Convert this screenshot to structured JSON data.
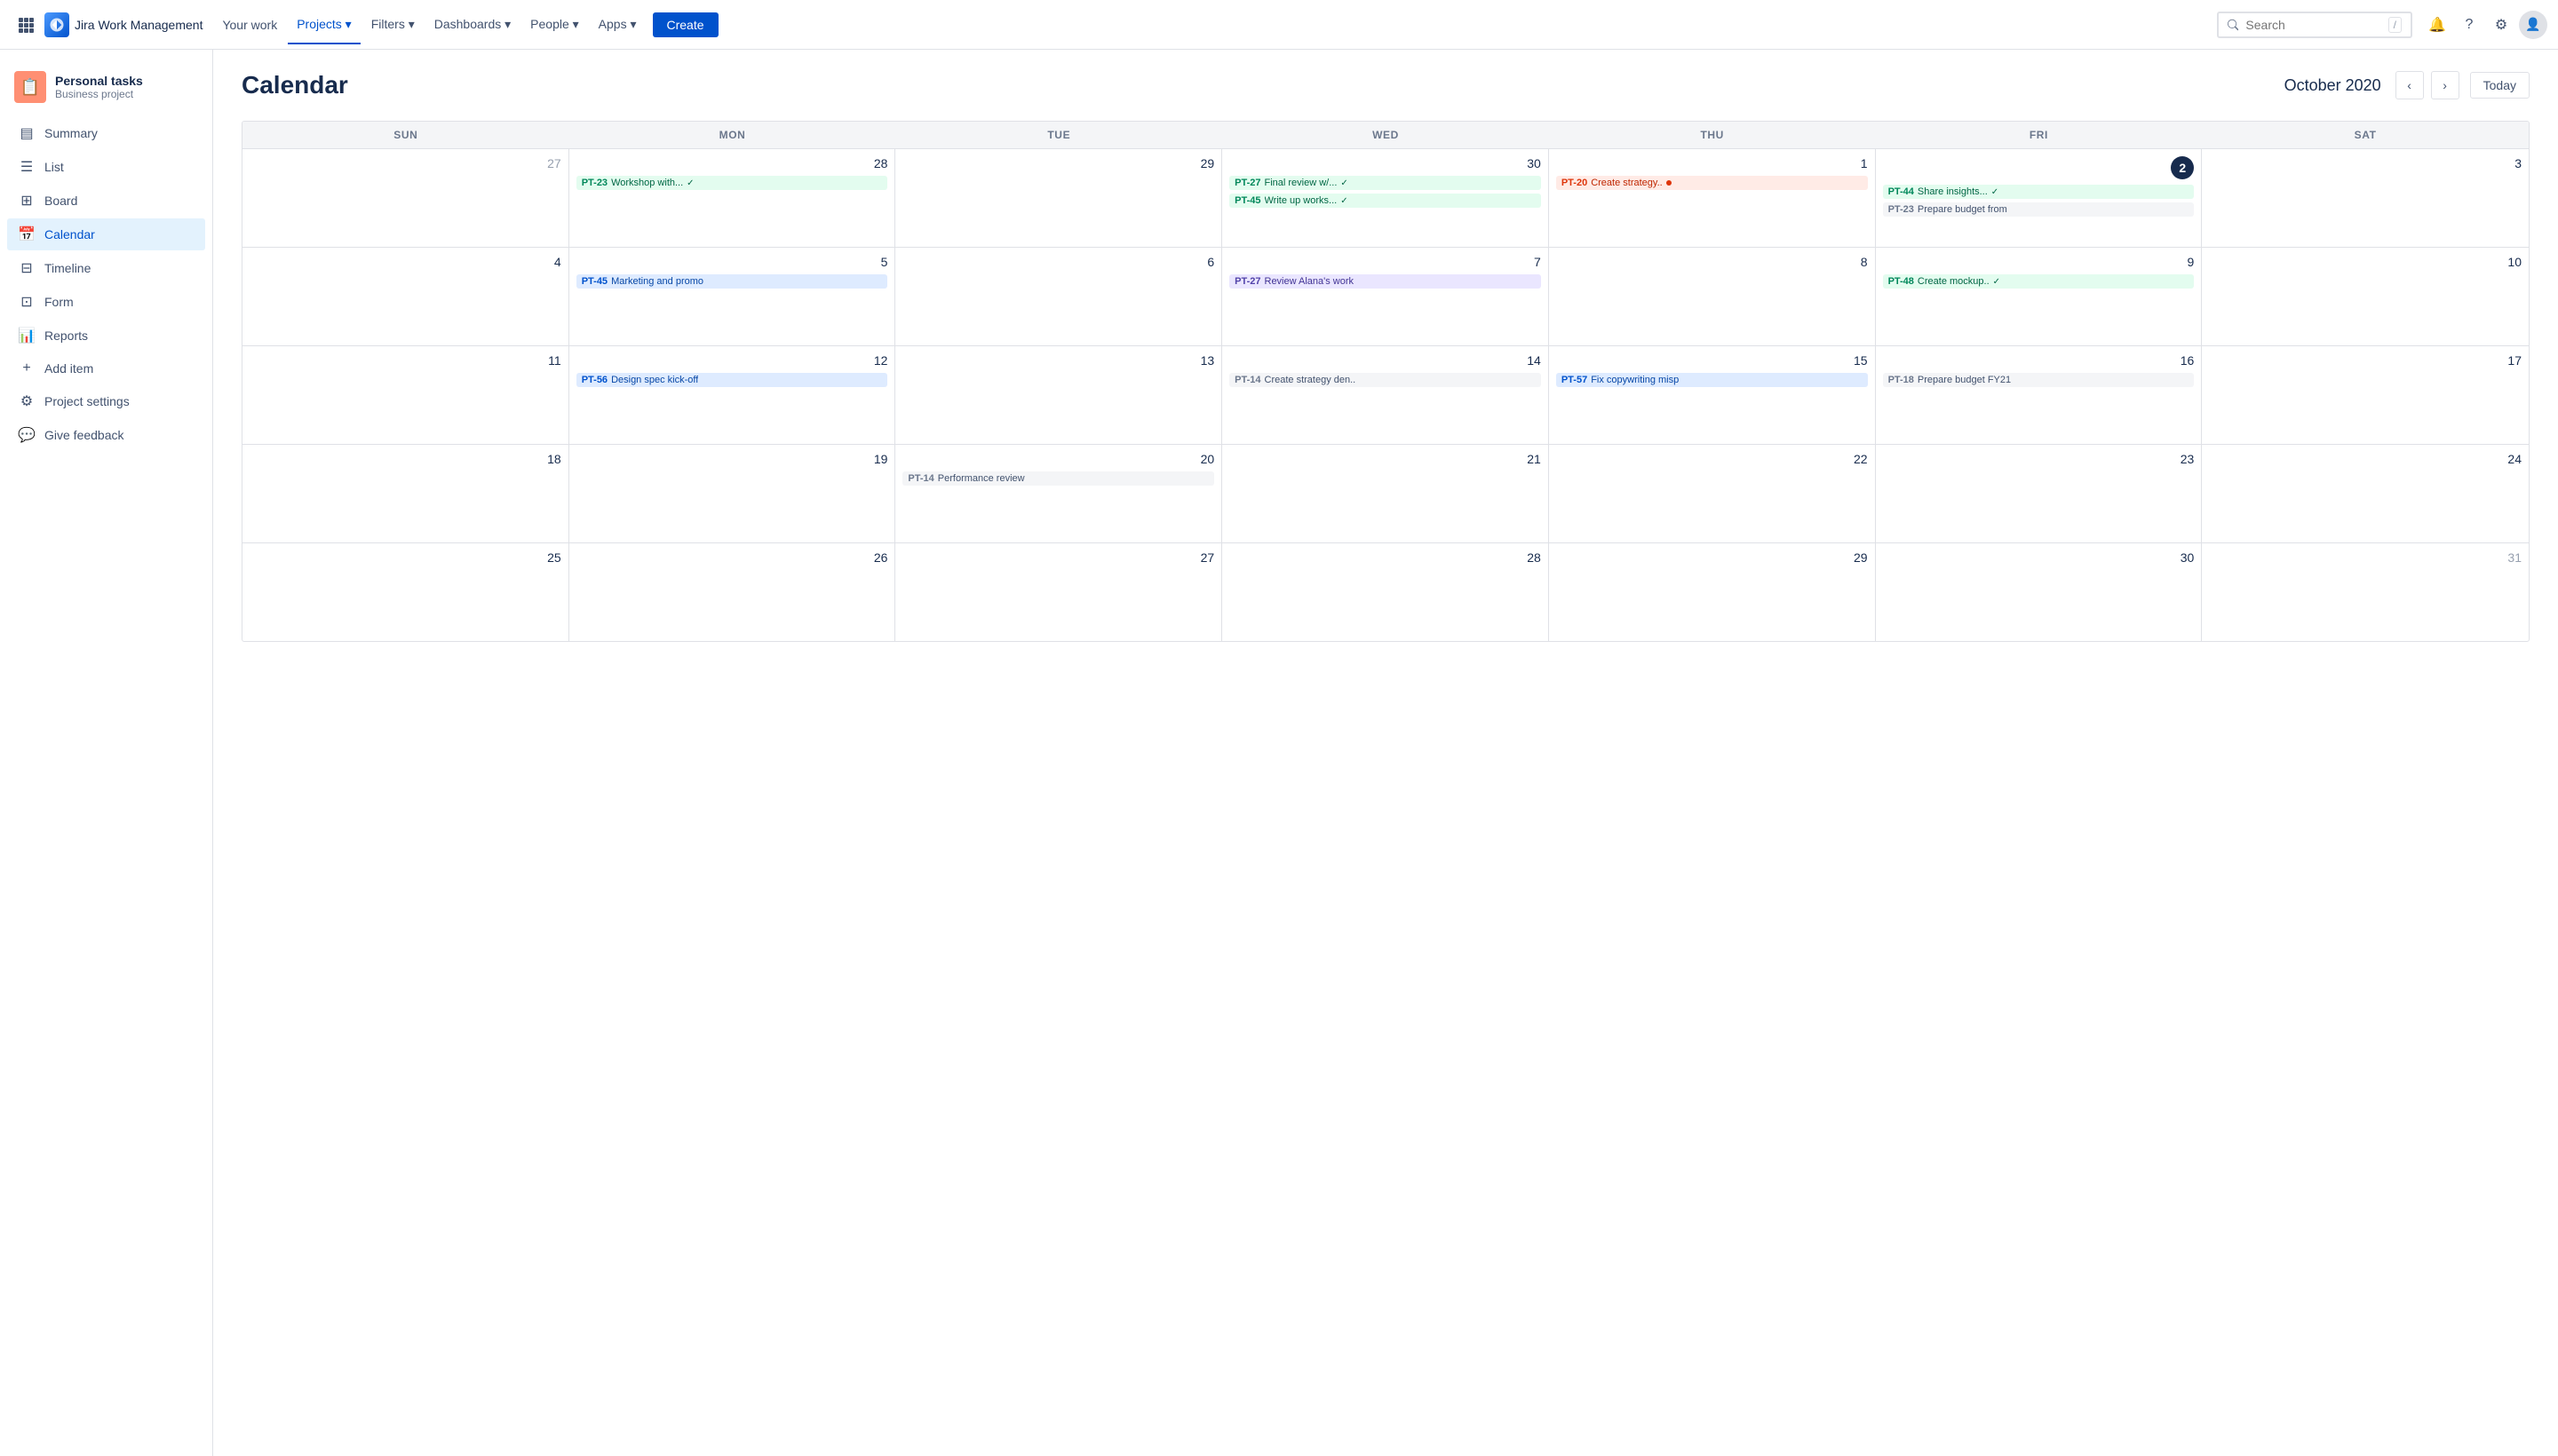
{
  "topnav": {
    "logo_text": "Jira Work Management",
    "nav_items": [
      {
        "label": "Your work",
        "active": false
      },
      {
        "label": "Projects",
        "active": true
      },
      {
        "label": "Filters",
        "active": false
      },
      {
        "label": "Dashboards",
        "active": false
      },
      {
        "label": "People",
        "active": false
      },
      {
        "label": "Apps",
        "active": false
      }
    ],
    "create_label": "Create",
    "search_placeholder": "Search",
    "search_shortcut": "/"
  },
  "sidebar": {
    "project_name": "Personal tasks",
    "project_type": "Business project",
    "nav_items": [
      {
        "id": "summary",
        "icon": "▤",
        "label": "Summary",
        "active": false
      },
      {
        "id": "list",
        "icon": "☰",
        "label": "List",
        "active": false
      },
      {
        "id": "board",
        "icon": "⊞",
        "label": "Board",
        "active": false
      },
      {
        "id": "calendar",
        "icon": "📅",
        "label": "Calendar",
        "active": true
      },
      {
        "id": "timeline",
        "icon": "⊟",
        "label": "Timeline",
        "active": false
      },
      {
        "id": "form",
        "icon": "⊡",
        "label": "Form",
        "active": false
      },
      {
        "id": "reports",
        "icon": "📊",
        "label": "Reports",
        "active": false
      },
      {
        "id": "add-item",
        "icon": "+",
        "label": "Add item",
        "active": false
      },
      {
        "id": "project-settings",
        "icon": "⚙",
        "label": "Project settings",
        "active": false
      },
      {
        "id": "give-feedback",
        "icon": "💬",
        "label": "Give feedback",
        "active": false
      }
    ]
  },
  "calendar": {
    "title": "Calendar",
    "month": "October 2020",
    "today_label": "Today",
    "day_headers": [
      "SUN",
      "MON",
      "TUE",
      "WED",
      "THU",
      "FRI",
      "SAT"
    ],
    "weeks": [
      {
        "days": [
          {
            "date": "27",
            "other_month": true,
            "tasks": []
          },
          {
            "date": "28",
            "other_month": false,
            "tasks": [
              {
                "id": "PT-23",
                "name": "Workshop with...",
                "style": "green",
                "check": true
              }
            ]
          },
          {
            "date": "29",
            "other_month": false,
            "tasks": []
          },
          {
            "date": "30",
            "other_month": false,
            "tasks": [
              {
                "id": "PT-27",
                "name": "Final review w/...",
                "style": "green",
                "check": true
              },
              {
                "id": "PT-45",
                "name": "Write up works...",
                "style": "green",
                "check": true
              }
            ]
          },
          {
            "date": "1",
            "other_month": false,
            "tasks": [
              {
                "id": "PT-20",
                "name": "Create strategy..",
                "style": "red",
                "check": false,
                "dot": true
              }
            ]
          },
          {
            "date": "2",
            "other_month": false,
            "today": true,
            "tasks": [
              {
                "id": "PT-44",
                "name": "Share insights...",
                "style": "green",
                "check": true
              },
              {
                "id": "PT-23",
                "name": "Prepare budget from",
                "style": "gray",
                "check": false
              }
            ]
          },
          {
            "date": "3",
            "other_month": false,
            "tasks": []
          }
        ]
      },
      {
        "days": [
          {
            "date": "4",
            "other_month": false,
            "tasks": []
          },
          {
            "date": "5",
            "other_month": false,
            "tasks": [
              {
                "id": "PT-45",
                "name": "Marketing and promo",
                "style": "blue",
                "check": false
              }
            ]
          },
          {
            "date": "6",
            "other_month": false,
            "tasks": []
          },
          {
            "date": "7",
            "other_month": false,
            "tasks": [
              {
                "id": "PT-27",
                "name": "Review Alana's work",
                "style": "purple",
                "check": false
              }
            ]
          },
          {
            "date": "8",
            "other_month": false,
            "tasks": []
          },
          {
            "date": "9",
            "other_month": false,
            "tasks": [
              {
                "id": "PT-48",
                "name": "Create mockup..",
                "style": "green",
                "check": true
              }
            ]
          },
          {
            "date": "10",
            "other_month": false,
            "tasks": []
          }
        ]
      },
      {
        "days": [
          {
            "date": "11",
            "other_month": false,
            "tasks": []
          },
          {
            "date": "12",
            "other_month": false,
            "tasks": [
              {
                "id": "PT-56",
                "name": "Design spec kick-off",
                "style": "blue",
                "check": false
              }
            ]
          },
          {
            "date": "13",
            "other_month": false,
            "tasks": []
          },
          {
            "date": "14",
            "other_month": false,
            "tasks": [
              {
                "id": "PT-14",
                "name": "Create strategy den..",
                "style": "gray",
                "check": false
              }
            ]
          },
          {
            "date": "15",
            "other_month": false,
            "tasks": [
              {
                "id": "PT-57",
                "name": "Fix copywriting misp",
                "style": "blue",
                "check": false
              }
            ]
          },
          {
            "date": "16",
            "other_month": false,
            "tasks": [
              {
                "id": "PT-18",
                "name": "Prepare budget FY21",
                "style": "gray",
                "check": false
              }
            ]
          },
          {
            "date": "17",
            "other_month": false,
            "tasks": []
          }
        ]
      },
      {
        "days": [
          {
            "date": "18",
            "other_month": false,
            "tasks": []
          },
          {
            "date": "19",
            "other_month": false,
            "tasks": []
          },
          {
            "date": "20",
            "other_month": false,
            "tasks": [
              {
                "id": "PT-14",
                "name": "Performance review",
                "style": "gray",
                "check": false
              }
            ]
          },
          {
            "date": "21",
            "other_month": false,
            "tasks": []
          },
          {
            "date": "22",
            "other_month": false,
            "tasks": []
          },
          {
            "date": "23",
            "other_month": false,
            "tasks": []
          },
          {
            "date": "24",
            "other_month": false,
            "tasks": []
          }
        ]
      },
      {
        "days": [
          {
            "date": "25",
            "other_month": false,
            "tasks": []
          },
          {
            "date": "26",
            "other_month": false,
            "tasks": []
          },
          {
            "date": "27",
            "other_month": false,
            "tasks": []
          },
          {
            "date": "28",
            "other_month": false,
            "tasks": []
          },
          {
            "date": "29",
            "other_month": false,
            "tasks": []
          },
          {
            "date": "30",
            "other_month": false,
            "tasks": []
          },
          {
            "date": "31",
            "other_month": false,
            "tasks": []
          }
        ]
      }
    ]
  }
}
